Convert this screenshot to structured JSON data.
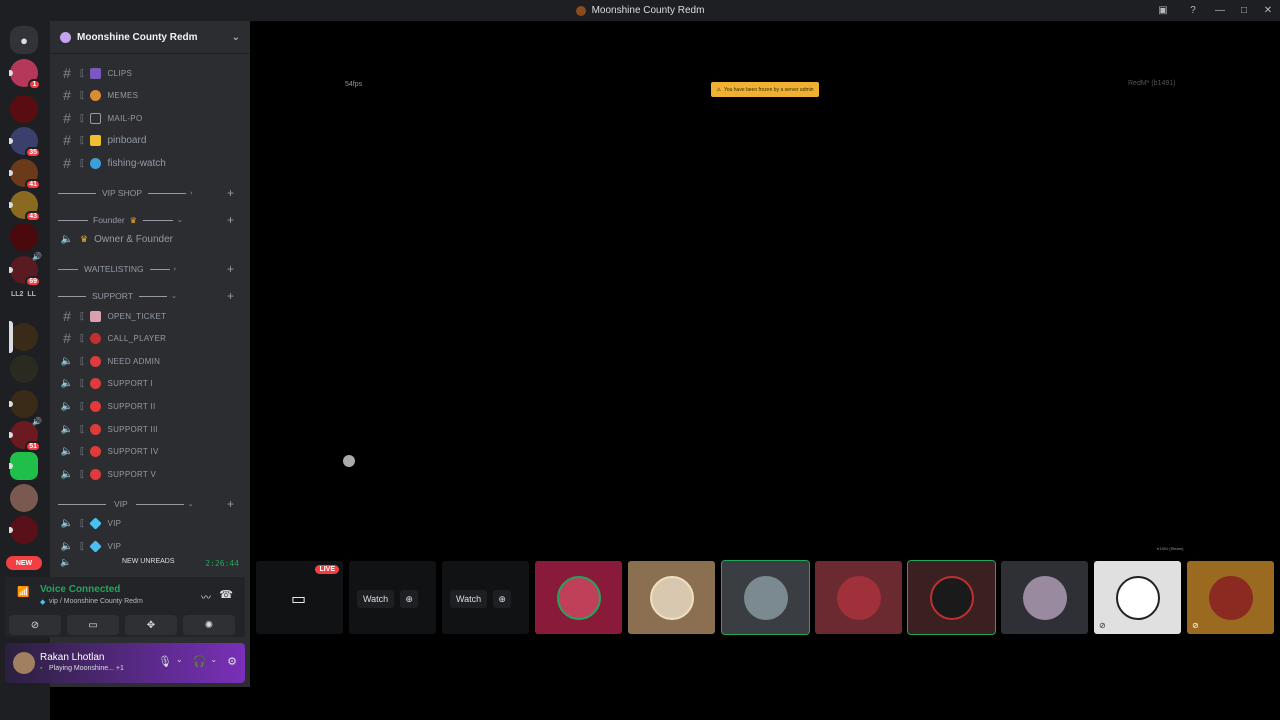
{
  "window": {
    "title": "Moonshine County Redm"
  },
  "rail": {
    "badges": [
      "1",
      "35",
      "41",
      "43",
      "69",
      "51"
    ],
    "labels": [
      "LL2",
      "LL"
    ],
    "new_label": "NEW"
  },
  "server": {
    "name": "Moonshine County Redm"
  },
  "channels": {
    "clips": "CLIPS",
    "memes": "MEMES",
    "mailpo": "MAIL-PO",
    "pinboard": "pinboard",
    "fishing": "fishing-watch",
    "vipshop": "VIP SHOP",
    "founder": "Founder",
    "owner": "Owner & Founder",
    "waitlisting": "WAITELISTING",
    "support": "SUPPORT",
    "open_ticket": "OPEN_TICKET",
    "call_player": "CALL_PLAYER",
    "need_admin": "NEED ADMIN",
    "support1": "SUPPORT I",
    "support2": "SUPPORT II",
    "support3": "SUPPORT III",
    "support4": "SUPPORT IV",
    "support5": "SUPPORT V",
    "vip_cat": "VIP",
    "vip1": "VIP",
    "vip2": "VIP"
  },
  "unreads": {
    "label": "NEW UNREADS",
    "timer": "2:26:44"
  },
  "voice": {
    "status": "Voice Connected",
    "location": "vip / Moonshine County Redm"
  },
  "user": {
    "name": "Rakan Lhotlan",
    "status": "Playing Moonshine... +1"
  },
  "stream": {
    "fps": "54fps",
    "notice": "You have been frozen by a server admin",
    "corner": "RedM* (b1491)",
    "tiny": "b1491 (Steam)",
    "live_label": "LIVE",
    "watch_label": "Watch"
  }
}
